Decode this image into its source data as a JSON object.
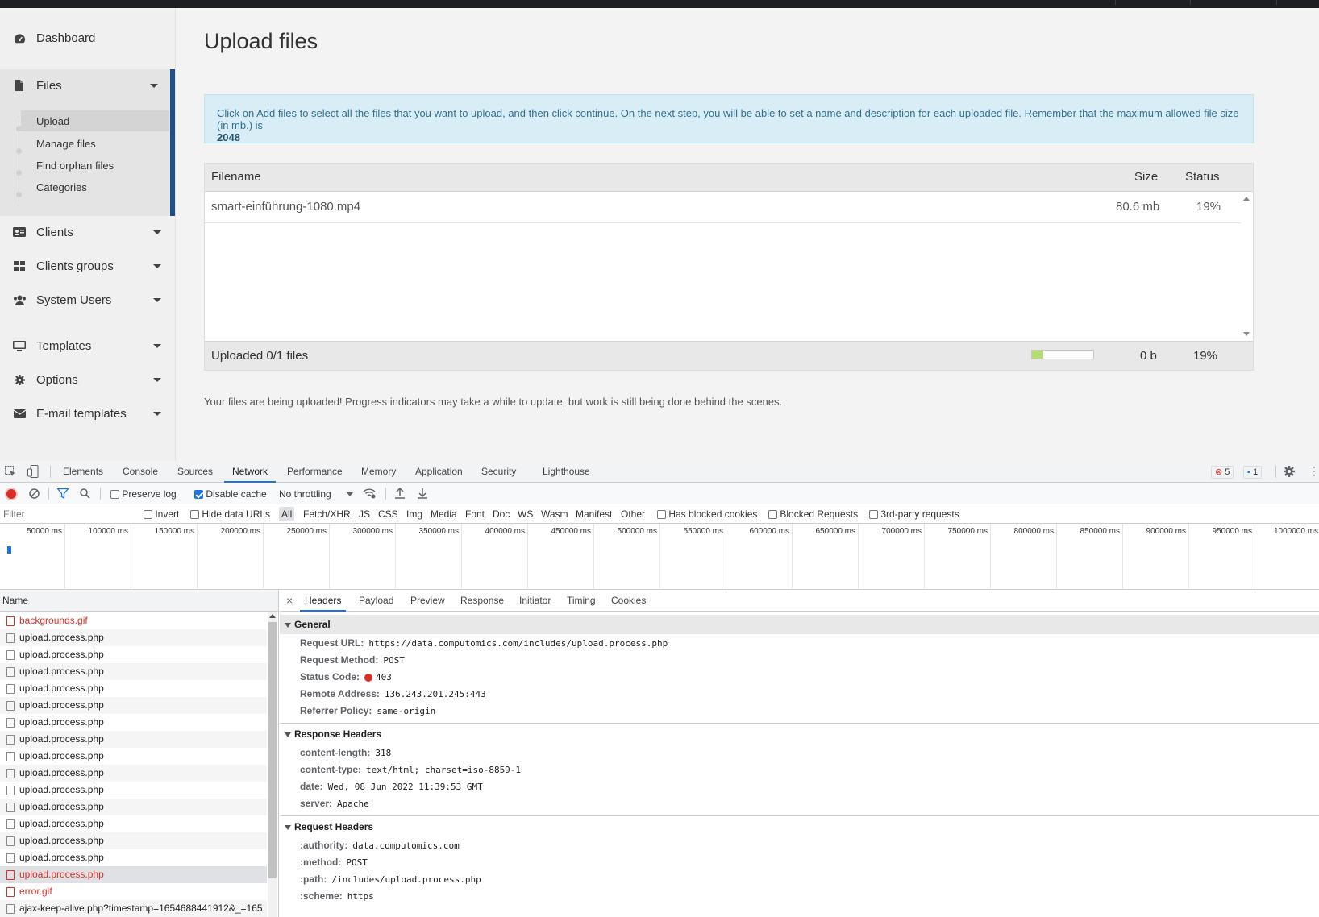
{
  "sidebar": {
    "dashboard": "Dashboard",
    "files": "Files",
    "files_sub": [
      "Upload",
      "Manage files",
      "Find orphan files",
      "Categories"
    ],
    "clients": "Clients",
    "clients_groups": "Clients groups",
    "system_users": "System Users",
    "templates": "Templates",
    "options": "Options",
    "email_templates": "E-mail templates"
  },
  "main": {
    "title": "Upload files",
    "alert_text": "Click on Add files to select all the files that you want to upload, and then click continue. On the next step, you will be able to set a name and description for each uploaded file. Remember that the maximum allowed file size (in mb.) is",
    "alert_max": "2048",
    "table": {
      "col_filename": "Filename",
      "col_size": "Size",
      "col_status": "Status",
      "row": {
        "filename": "smart-einführung-1080.mp4",
        "size": "80.6 mb",
        "status": "19%"
      },
      "footer_label": "Uploaded 0/1 files",
      "footer_size": "0 b",
      "footer_percent": "19%",
      "progress_fraction": 0.19
    },
    "note": "Your files are being uploaded! Progress indicators may take a while to update, but work is still being done behind the scenes."
  },
  "devtools": {
    "tabs": [
      "Elements",
      "Console",
      "Sources",
      "Network",
      "Performance",
      "Memory",
      "Application",
      "Security",
      "Lighthouse"
    ],
    "active_tab": "Network",
    "errors_count": "5",
    "messages_count": "1",
    "toolbar": {
      "preserve_log": "Preserve log",
      "disable_cache": "Disable cache",
      "throttling": "No throttling"
    },
    "filter": {
      "placeholder": "Filter",
      "invert": "Invert",
      "hide_data_urls": "Hide data URLs",
      "types": [
        "All",
        "Fetch/XHR",
        "JS",
        "CSS",
        "Img",
        "Media",
        "Font",
        "Doc",
        "WS",
        "Wasm",
        "Manifest",
        "Other"
      ],
      "has_blocked_cookies": "Has blocked cookies",
      "blocked_requests": "Blocked Requests",
      "third_party": "3rd-party requests"
    },
    "timeline_labels": [
      "50000 ms",
      "100000 ms",
      "150000 ms",
      "200000 ms",
      "250000 ms",
      "300000 ms",
      "350000 ms",
      "400000 ms",
      "450000 ms",
      "500000 ms",
      "550000 ms",
      "600000 ms",
      "650000 ms",
      "700000 ms",
      "750000 ms",
      "800000 ms",
      "850000 ms",
      "900000 ms",
      "950000 ms",
      "1000000 ms"
    ],
    "name_header": "Name",
    "requests": [
      {
        "name": "backgrounds.gif",
        "error": true
      },
      {
        "name": "upload.process.php",
        "error": false
      },
      {
        "name": "upload.process.php",
        "error": false
      },
      {
        "name": "upload.process.php",
        "error": false
      },
      {
        "name": "upload.process.php",
        "error": false
      },
      {
        "name": "upload.process.php",
        "error": false
      },
      {
        "name": "upload.process.php",
        "error": false
      },
      {
        "name": "upload.process.php",
        "error": false
      },
      {
        "name": "upload.process.php",
        "error": false
      },
      {
        "name": "upload.process.php",
        "error": false
      },
      {
        "name": "upload.process.php",
        "error": false
      },
      {
        "name": "upload.process.php",
        "error": false
      },
      {
        "name": "upload.process.php",
        "error": false
      },
      {
        "name": "upload.process.php",
        "error": false
      },
      {
        "name": "upload.process.php",
        "error": false
      },
      {
        "name": "upload.process.php",
        "error": true,
        "selected": true
      },
      {
        "name": "error.gif",
        "error": true
      },
      {
        "name": "ajax-keep-alive.php?timestamp=1654688441912&_=165.",
        "error": false
      }
    ],
    "detail_tabs": [
      "Headers",
      "Payload",
      "Preview",
      "Response",
      "Initiator",
      "Timing",
      "Cookies"
    ],
    "close_symbol": "×",
    "general": {
      "title": "General",
      "items": [
        {
          "k": "Request URL:",
          "v": "https://data.computomics.com/includes/upload.process.php"
        },
        {
          "k": "Request Method:",
          "v": "POST"
        },
        {
          "k": "Status Code:",
          "v": "403"
        },
        {
          "k": "Remote Address:",
          "v": "136.243.201.245:443"
        },
        {
          "k": "Referrer Policy:",
          "v": "same-origin"
        }
      ]
    },
    "response_headers": {
      "title": "Response Headers",
      "items": [
        {
          "k": "content-length:",
          "v": "318"
        },
        {
          "k": "content-type:",
          "v": "text/html; charset=iso-8859-1"
        },
        {
          "k": "date:",
          "v": "Wed, 08 Jun 2022 11:39:53 GMT"
        },
        {
          "k": "server:",
          "v": "Apache"
        }
      ]
    },
    "request_headers": {
      "title": "Request Headers",
      "items": [
        {
          "k": ":authority:",
          "v": "data.computomics.com"
        },
        {
          "k": ":method:",
          "v": "POST"
        },
        {
          "k": ":path:",
          "v": "/includes/upload.process.php"
        },
        {
          "k": ":scheme:",
          "v": "https"
        }
      ]
    }
  }
}
